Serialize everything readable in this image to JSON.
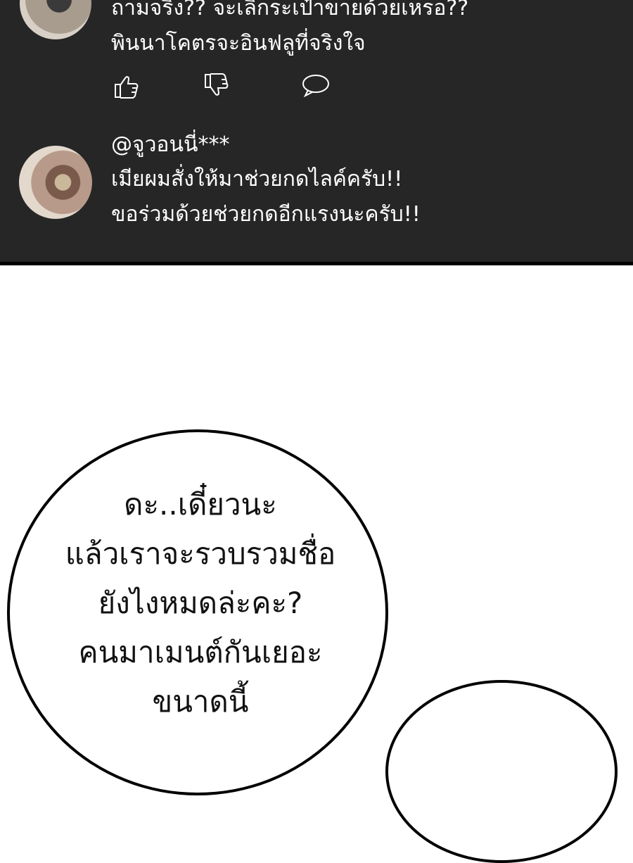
{
  "comments": [
    {
      "lines": [
        "ถามจริง?? จะเลิกระเป๋าขายด้วยเหรอ??",
        "พินนาโคตรจะอินฟลูที่จริงใจ"
      ]
    },
    {
      "username": "@จูวอนนี่***",
      "lines": [
        "เมียผมสั่งให้มาช่วยกดไลค์ครับ!!",
        "ขอร่วมด้วยช่วยกดอีกแรงนะครับ!!"
      ]
    }
  ],
  "action_icons": [
    "thumbs-up-icon",
    "thumbs-down-icon",
    "reply-bubble-icon"
  ],
  "speech_bubble": {
    "lines": [
      "ดะ..เดี๋ยวนะ",
      "แล้วเราจะรวบรวมชื่อ",
      "ยังไงหมดล่ะคะ?",
      "คนมาเมนต์กันเยอะ",
      "ขนาดนี้"
    ]
  },
  "colors": {
    "panel": "#262626",
    "text": "#ffffff",
    "page": "#ffffff",
    "ink": "#000000"
  }
}
